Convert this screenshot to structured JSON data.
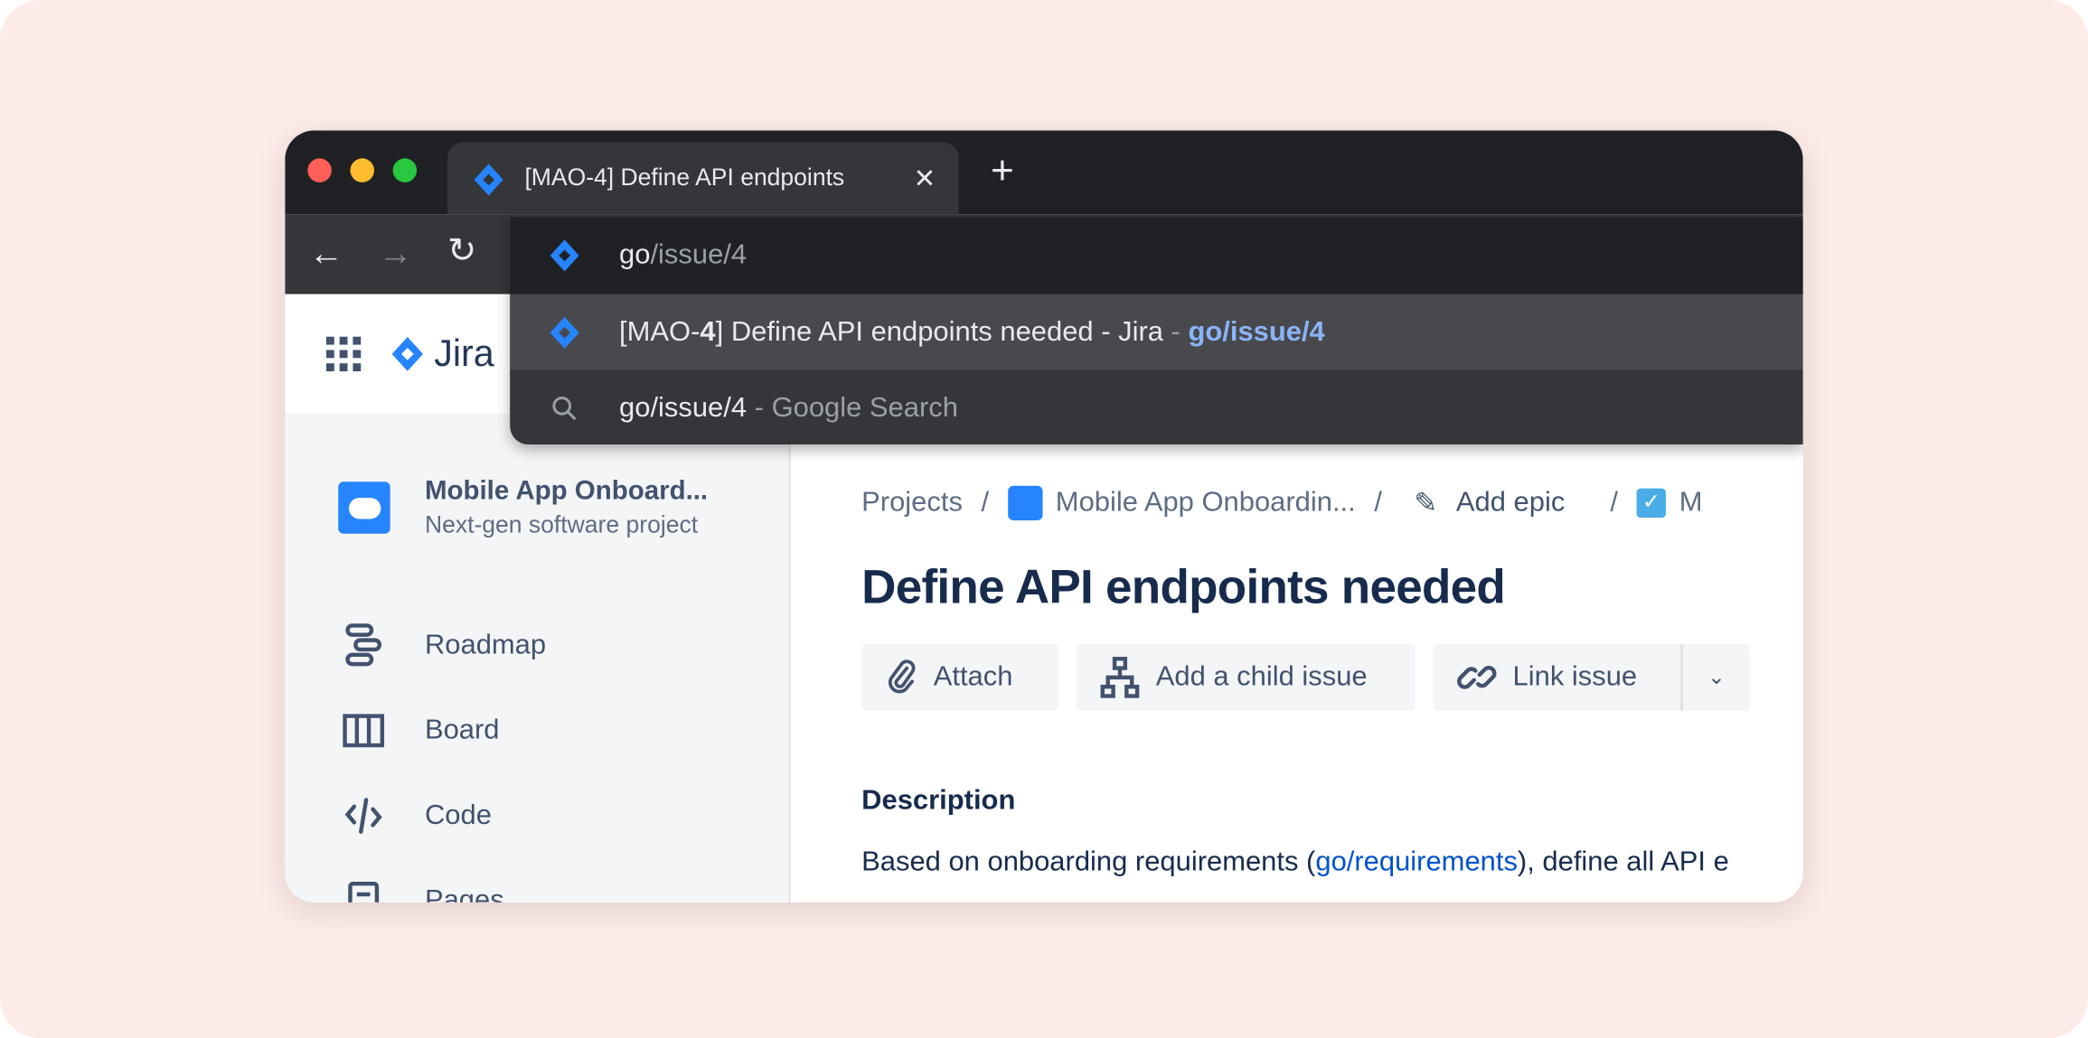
{
  "browser": {
    "tab_title": "[MAO-4] Define API endpoints",
    "new_tab": "+",
    "close_tab": "✕"
  },
  "omnibox": {
    "typed": "go",
    "autocomplete": "/issue/4",
    "suggestions": [
      {
        "prefix": "[MAO-",
        "bold": "4",
        "rest": "] Define API endpoints needed - Jira",
        "sep": " - ",
        "url": "go/issue/4",
        "icon": "jira-icon"
      },
      {
        "query": "go/issue/4",
        "suffix": " - Google Search",
        "icon": "search-icon"
      }
    ]
  },
  "jira": {
    "logo_text": "Jira",
    "accent": "#2684ff"
  },
  "sidebar": {
    "project_name": "Mobile App Onboard...",
    "project_type": "Next-gen software project",
    "items": [
      {
        "label": "Roadmap",
        "icon": "roadmap-icon"
      },
      {
        "label": "Board",
        "icon": "board-icon"
      },
      {
        "label": "Code",
        "icon": "code-icon"
      },
      {
        "label": "Pages",
        "icon": "pages-icon"
      }
    ]
  },
  "breadcrumb": {
    "projects": "Projects",
    "project": "Mobile App Onboardin...",
    "epic": "Add epic",
    "issue_partial": "M",
    "sep": "/"
  },
  "issue": {
    "title": "Define API endpoints needed",
    "actions": {
      "attach": "Attach",
      "child": "Add a child issue",
      "link": "Link issue"
    },
    "description_heading": "Description",
    "description_pre": "Based on onboarding requirements (",
    "description_link": "go/requirements",
    "description_post": "), define all API e"
  }
}
